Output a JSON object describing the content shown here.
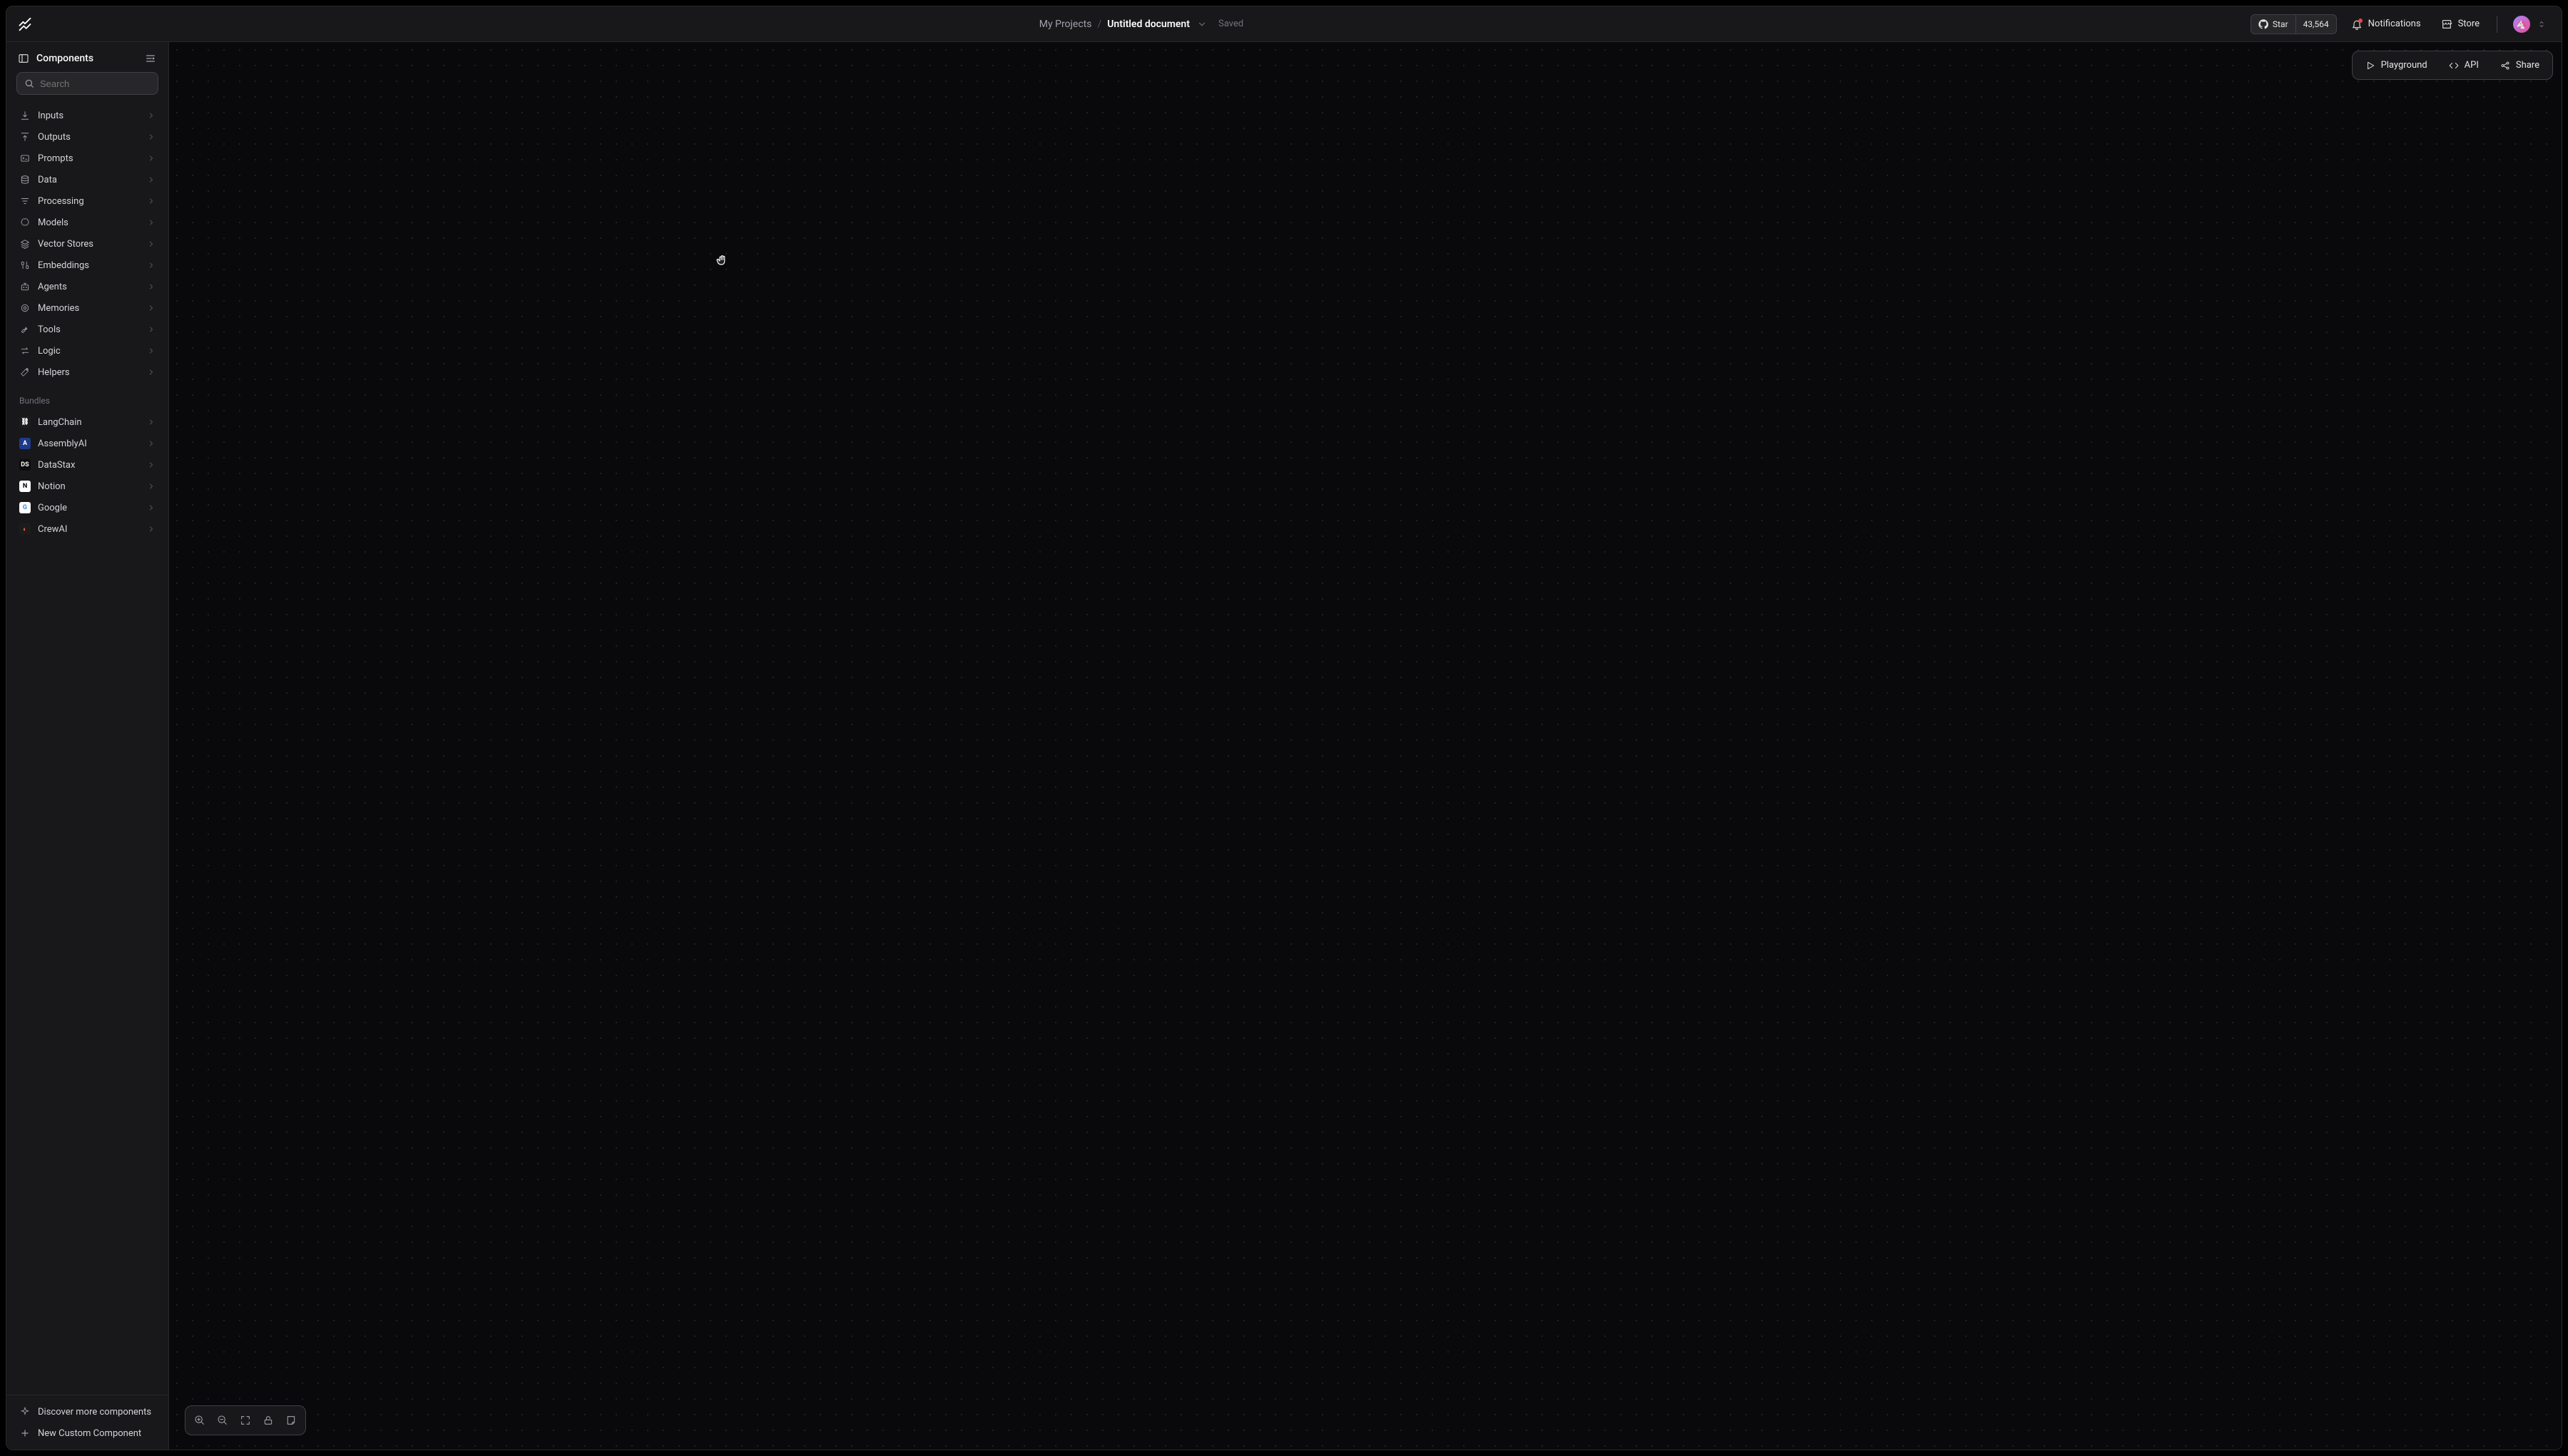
{
  "header": {
    "breadcrumb_root": "My Projects",
    "breadcrumb_current": "Untitled document",
    "saved_label": "Saved",
    "star_label": "Star",
    "star_count": "43,564",
    "notifications_label": "Notifications",
    "store_label": "Store"
  },
  "sidebar": {
    "title": "Components",
    "search_placeholder": "Search",
    "search_key": "/",
    "categories": [
      {
        "label": "Inputs",
        "icon": "download-icon"
      },
      {
        "label": "Outputs",
        "icon": "upload-icon"
      },
      {
        "label": "Prompts",
        "icon": "prompt-icon"
      },
      {
        "label": "Data",
        "icon": "database-icon"
      },
      {
        "label": "Processing",
        "icon": "filter-icon"
      },
      {
        "label": "Models",
        "icon": "brain-icon"
      },
      {
        "label": "Vector Stores",
        "icon": "layers-icon"
      },
      {
        "label": "Embeddings",
        "icon": "binary-icon"
      },
      {
        "label": "Agents",
        "icon": "bot-icon"
      },
      {
        "label": "Memories",
        "icon": "memory-icon"
      },
      {
        "label": "Tools",
        "icon": "wrench-icon"
      },
      {
        "label": "Logic",
        "icon": "swap-icon"
      },
      {
        "label": "Helpers",
        "icon": "wand-icon"
      }
    ],
    "bundles_label": "Bundles",
    "bundles": [
      {
        "label": "LangChain",
        "icon": "langchain-icon",
        "bg": "#1c1c1c",
        "fg": "#ffffff",
        "glyph": "⛓"
      },
      {
        "label": "AssemblyAI",
        "icon": "assemblyai-icon",
        "bg": "#1e3a8a",
        "fg": "#ffffff",
        "glyph": "A"
      },
      {
        "label": "DataStax",
        "icon": "datastax-icon",
        "bg": "#0c0c0c",
        "fg": "#ffffff",
        "glyph": "DS"
      },
      {
        "label": "Notion",
        "icon": "notion-icon",
        "bg": "#ffffff",
        "fg": "#000000",
        "glyph": "N"
      },
      {
        "label": "Google",
        "icon": "google-icon",
        "bg": "#ffffff",
        "fg": "#4285F4",
        "glyph": "G"
      },
      {
        "label": "CrewAI",
        "icon": "crewai-icon",
        "bg": "#1c1c1c",
        "fg": "#ff6b35",
        "glyph": "◐"
      }
    ],
    "discover_label": "Discover more components",
    "new_component_label": "New Custom Component"
  },
  "toolbar_tr": {
    "playground": "Playground",
    "api": "API",
    "share": "Share"
  },
  "toolbar_bl": {
    "zoom_in": "zoom-in",
    "zoom_out": "zoom-out",
    "fit": "fit-view",
    "lock": "unlock",
    "note": "note"
  }
}
